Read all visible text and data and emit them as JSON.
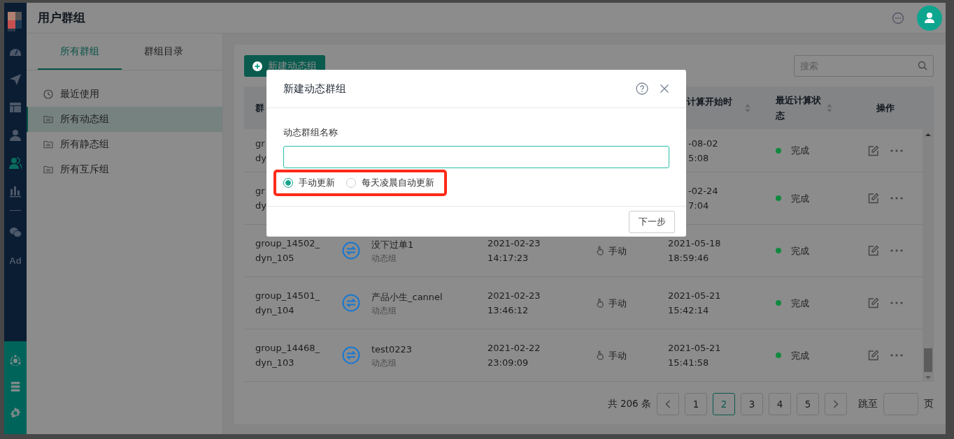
{
  "rail": {
    "items": [
      {
        "kind": "dashboard",
        "selected": false
      },
      {
        "kind": "send",
        "selected": false
      },
      {
        "kind": "layout",
        "selected": false
      },
      {
        "kind": "user",
        "selected": false
      },
      {
        "kind": "users",
        "selected": true
      },
      {
        "kind": "chart",
        "selected": false
      },
      {
        "kind": "divider"
      },
      {
        "kind": "wechat",
        "selected": false
      },
      {
        "kind": "text",
        "label": "Ad",
        "selected": false
      }
    ],
    "bottom_items": [
      {
        "kind": "network"
      },
      {
        "kind": "server"
      },
      {
        "kind": "settings"
      }
    ]
  },
  "header": {
    "title": "用户群组"
  },
  "left_panel": {
    "tabs": [
      {
        "label": "所有群组",
        "selected": true
      },
      {
        "label": "群组目录",
        "selected": false
      }
    ],
    "items": [
      {
        "kind": "recent",
        "label": "最近使用",
        "selected": false
      },
      {
        "kind": "dynamic",
        "label": "所有动态组",
        "selected": true
      },
      {
        "kind": "static",
        "label": "所有静态组",
        "selected": false
      },
      {
        "kind": "mutex",
        "label": "所有互斥组",
        "selected": false
      }
    ]
  },
  "toolbar": {
    "new_button": "新建动态组",
    "search": {
      "placeholder": "搜索"
    }
  },
  "table": {
    "columns": [
      {
        "label": "群"
      },
      {},
      {},
      {},
      {
        "label": "计算开始时",
        "sortable": true
      },
      {
        "label": "最近计算状态",
        "sortable": true
      },
      {
        "label": "操作"
      }
    ],
    "rows": [
      {
        "id": [
          "gr",
          "dy"
        ],
        "last_calc": [
          "-08-02",
          "5:08"
        ],
        "status": "完成",
        "color": "#11893f"
      },
      {
        "id": [
          "gr",
          "dy"
        ],
        "last_calc": [
          "-02-24",
          "7:04"
        ],
        "status": "完成",
        "color": "#11893f"
      },
      {
        "id": [
          "group_14502_",
          "dyn_105"
        ],
        "name": "没下过单1",
        "type": "动态组",
        "created": [
          "2021-02-23",
          "14:17:23"
        ],
        "update": "手动",
        "last_calc": [
          "2021-05-18",
          "18:59:46"
        ],
        "status": "完成",
        "color": "#11893f"
      },
      {
        "id": [
          "group_14501_",
          "dyn_104"
        ],
        "name": "产品小生_cannel",
        "type": "动态组",
        "created": [
          "2021-02-23",
          "13:46:12"
        ],
        "update": "手动",
        "last_calc": [
          "2021-05-21",
          "15:42:14"
        ],
        "status": "完成",
        "color": "#11893f"
      },
      {
        "id": [
          "group_14468_",
          "dyn_103"
        ],
        "name": "test0223",
        "type": "动态组",
        "created": [
          "2021-02-22",
          "23:09:09"
        ],
        "update": "手动",
        "last_calc": [
          "2021-05-21",
          "15:41:58"
        ],
        "status": "完成",
        "color": "#11893f"
      }
    ]
  },
  "pagination": {
    "total": "共 206 条",
    "pages": [
      {
        "label": "1",
        "selected": false
      },
      {
        "label": "2",
        "selected": true
      },
      {
        "label": "3",
        "selected": false
      },
      {
        "label": "4",
        "selected": false
      },
      {
        "label": "5",
        "selected": false
      }
    ],
    "jump_label": "跳至",
    "page_suffix": "页"
  },
  "dialog": {
    "title": "新建动态群组",
    "field_label": "动态群组名称",
    "options": [
      {
        "label": "手动更新",
        "selected": true
      },
      {
        "label": "每天凌晨自动更新",
        "selected": false
      }
    ],
    "highlighted": true,
    "next_button": "下一步"
  }
}
